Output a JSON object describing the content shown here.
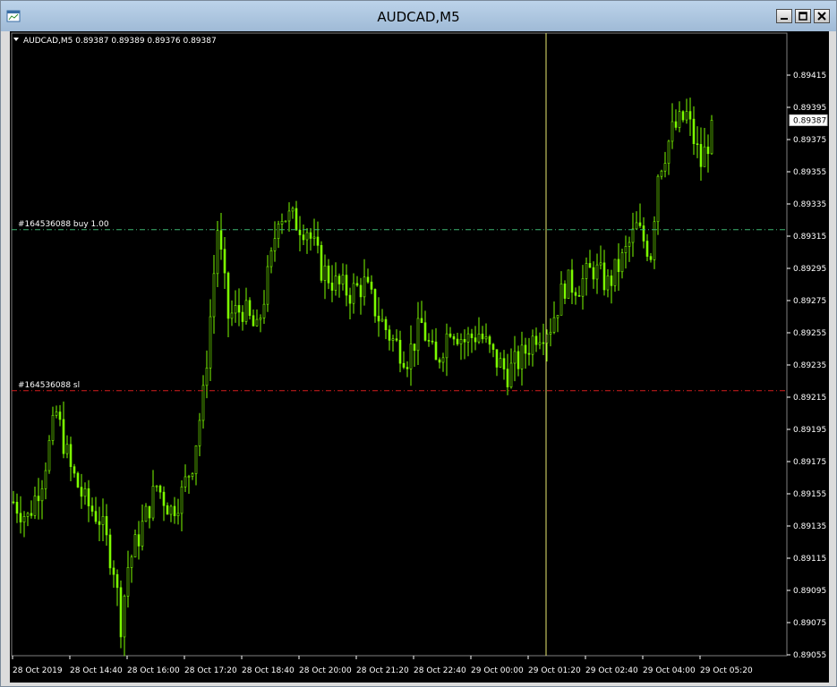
{
  "window": {
    "title": "AUDCAD,M5",
    "icon": "chart-window-icon",
    "controls": [
      "minimize-icon",
      "restore-icon",
      "close-icon"
    ]
  },
  "chart_header": {
    "text": "AUDCAD,M5  0.89387 0.89389 0.89376 0.89387"
  },
  "current_price_label": "0.89387",
  "order_lines": [
    {
      "label": "#164536088 buy 1.00",
      "price": 0.89319,
      "color": "#3cb371"
    },
    {
      "label": "#164536088 sl",
      "price": 0.89219,
      "color": "#d41e1e"
    }
  ],
  "colors": {
    "background": "#000000",
    "candle": "#7cfc00",
    "grid_text": "#ffffff",
    "crosshair": "#ffff66"
  },
  "chart_data": {
    "type": "candlestick",
    "symbol": "AUDCAD",
    "timeframe": "M5",
    "ylim": [
      0.89055,
      0.89425
    ],
    "y_ticks": [
      0.89415,
      0.89395,
      0.89375,
      0.89355,
      0.89335,
      0.89315,
      0.89295,
      0.89275,
      0.89255,
      0.89235,
      0.89215,
      0.89195,
      0.89175,
      0.89155,
      0.89135,
      0.89115,
      0.89095,
      0.89075,
      0.89055
    ],
    "x_ticks": [
      {
        "label": "28 Oct 2019",
        "bar": 0
      },
      {
        "label": "28 Oct 14:40",
        "bar": 16
      },
      {
        "label": "28 Oct 16:00",
        "bar": 32
      },
      {
        "label": "28 Oct 17:20",
        "bar": 48
      },
      {
        "label": "28 Oct 18:40",
        "bar": 64
      },
      {
        "label": "28 Oct 20:00",
        "bar": 80
      },
      {
        "label": "28 Oct 21:20",
        "bar": 96
      },
      {
        "label": "28 Oct 22:40",
        "bar": 112
      },
      {
        "label": "29 Oct 00:00",
        "bar": 128
      },
      {
        "label": "29 Oct 01:20",
        "bar": 144
      },
      {
        "label": "29 Oct 02:40",
        "bar": 160
      },
      {
        "label": "29 Oct 04:00",
        "bar": 176
      },
      {
        "label": "29 Oct 05:20",
        "bar": 192
      }
    ],
    "bar_count": 196,
    "crosshair_bar": 149,
    "close_path": [
      [
        0,
        0.8915
      ],
      [
        4,
        0.8914
      ],
      [
        8,
        0.89165
      ],
      [
        12,
        0.89205
      ],
      [
        16,
        0.8917
      ],
      [
        20,
        0.8915
      ],
      [
        24,
        0.8914
      ],
      [
        28,
        0.8911
      ],
      [
        30,
        0.89075
      ],
      [
        32,
        0.8911
      ],
      [
        36,
        0.89135
      ],
      [
        40,
        0.8916
      ],
      [
        44,
        0.89145
      ],
      [
        47,
        0.89155
      ],
      [
        50,
        0.89175
      ],
      [
        53,
        0.89215
      ],
      [
        55,
        0.89265
      ],
      [
        57,
        0.8932
      ],
      [
        60,
        0.89265
      ],
      [
        64,
        0.8927
      ],
      [
        68,
        0.89255
      ],
      [
        72,
        0.893
      ],
      [
        74,
        0.8933
      ],
      [
        78,
        0.89325
      ],
      [
        82,
        0.8932
      ],
      [
        86,
        0.89295
      ],
      [
        90,
        0.89285
      ],
      [
        94,
        0.8928
      ],
      [
        98,
        0.89285
      ],
      [
        102,
        0.89265
      ],
      [
        106,
        0.8925
      ],
      [
        110,
        0.8924
      ],
      [
        114,
        0.8926
      ],
      [
        118,
        0.89235
      ],
      [
        122,
        0.8926
      ],
      [
        126,
        0.8925
      ],
      [
        130,
        0.89255
      ],
      [
        134,
        0.8924
      ],
      [
        138,
        0.8923
      ],
      [
        142,
        0.8924
      ],
      [
        146,
        0.89255
      ],
      [
        150,
        0.8926
      ],
      [
        154,
        0.89285
      ],
      [
        158,
        0.89285
      ],
      [
        162,
        0.89295
      ],
      [
        166,
        0.89285
      ],
      [
        170,
        0.893
      ],
      [
        174,
        0.8932
      ],
      [
        178,
        0.89305
      ],
      [
        180,
        0.89355
      ],
      [
        184,
        0.8938
      ],
      [
        188,
        0.8939
      ],
      [
        192,
        0.8936
      ],
      [
        196,
        0.89387
      ]
    ]
  }
}
